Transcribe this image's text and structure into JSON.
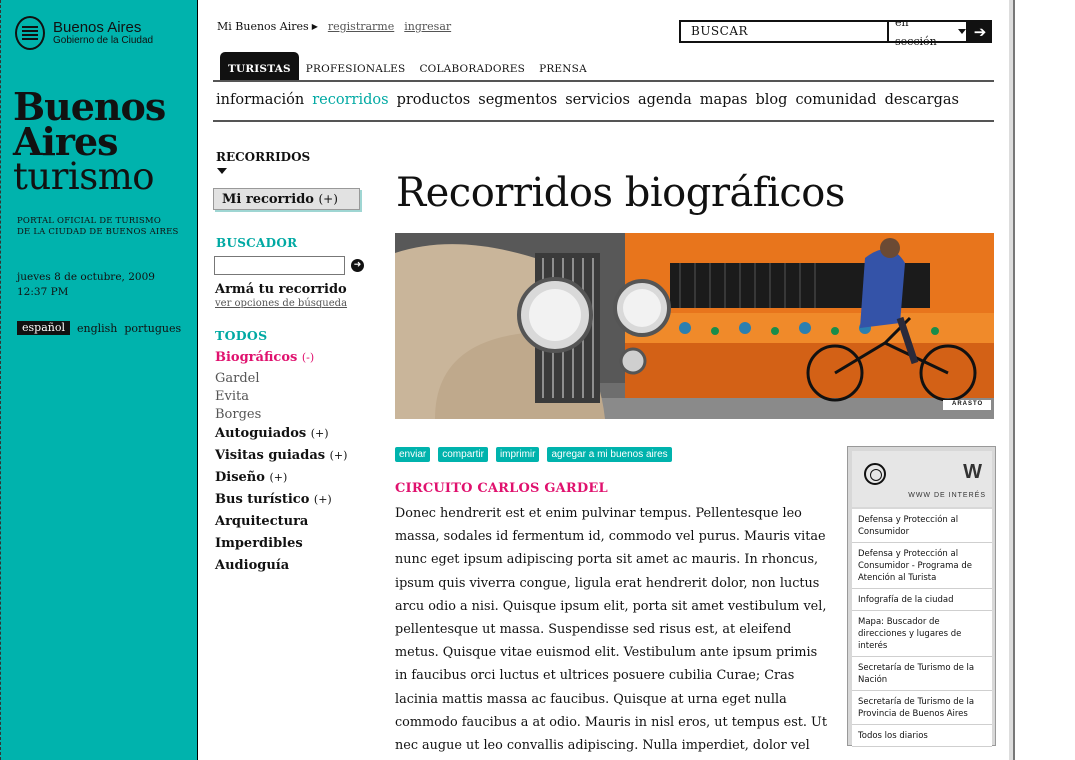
{
  "colors": {
    "teal": "#00b3ad",
    "pink": "#e0116e",
    "dark": "#111111"
  },
  "brand": {
    "logo_line1": "Buenos Aires",
    "logo_line2": "Gobierno de la Ciudad",
    "title_line1": "Buenos",
    "title_line2": "Aires",
    "title_line3": "turismo",
    "portal_line1": "PORTAL OFICIAL DE TURISMO",
    "portal_line2": "DE LA CIUDAD DE BUENOS AIRES",
    "date": "jueves 8 de octubre, 2009",
    "time": "12:37 PM"
  },
  "languages": [
    "español",
    "english",
    "portugues"
  ],
  "topnav": {
    "user": "Mi Buenos Aires",
    "register": "registrarme",
    "login": "ingresar"
  },
  "search": {
    "placeholder": "BUSCAR",
    "scope": "en sección"
  },
  "audience_tabs": [
    "TURISTAS",
    "PROFESIONALES",
    "COLABORADORES",
    "PRENSA"
  ],
  "main_nav": [
    "información",
    "recorridos",
    "productos",
    "segmentos",
    "servicios",
    "agenda",
    "mapas",
    "blog",
    "comunidad",
    "descargas"
  ],
  "sidebar": {
    "section_title": "RECORRIDOS",
    "mi_recorrido": "Mi recorrido",
    "mi_recorrido_toggle": "(+)",
    "buscador_title": "BUSCADOR",
    "arma": "Armá tu recorrido",
    "opciones": "ver opciones de búsqueda",
    "todos": "TODOS",
    "biograficos": "Biográficos",
    "biograficos_toggle": "(-)",
    "sub": [
      "Gardel",
      "Evita",
      "Borges"
    ],
    "autoguiados": "Autoguiados",
    "visitas": "Visitas guiadas",
    "diseno": "Diseño",
    "bus": "Bus turístico",
    "toggle": "(+)",
    "arquitectura": "Arquitectura",
    "imperdibles": "Imperdibles",
    "audioguia": "Audioguía"
  },
  "content": {
    "title": "Recorridos biográficos",
    "photo_credit": "ARASTO",
    "actions": [
      "enviar",
      "compartir",
      "imprimir",
      "agregar a mi buenos aires"
    ],
    "subtitle": "CIRCUITO CARLOS GARDEL",
    "body": "Donec hendrerit est et enim pulvinar tempus. Pellentesque leo massa, sodales id fermentum id, commodo vel purus. Mauris vitae nunc eget ipsum adipiscing porta sit amet ac mauris. In rhoncus, ipsum quis viverra congue, ligula erat hendrerit dolor, non luctus arcu odio a nisi. Quisque ipsum elit, porta sit amet vestibulum vel, pellentesque ut massa. Suspendisse sed risus est, at eleifend metus. Quisque vitae euismod elit. Vestibulum ante ipsum primis in faucibus orci luctus et ultrices posuere cubilia Curae; Cras lacinia mattis massa ac faucibus. Quisque at urna eget nulla commodo faucibus a at odio. Mauris in nisl eros, ut tempus est. Ut nec augue ut leo convallis adipiscing. Nulla imperdiet, dolor vel iaculis fermentum, dui elit dapibus ipsum, vitae"
  },
  "www": {
    "letter": "W",
    "label": "WWW DE INTERÉS",
    "links": [
      "Defensa y Protección al Consumidor",
      "Defensa y Protección al Consumidor - Programa de Atención al Turista",
      "Infografía de la ciudad",
      "Mapa: Buscador de direcciones y lugares de interés",
      "Secretaría de Turismo de la Nación",
      "Secretaría de Turismo de la Provincia de Buenos Aires",
      "Todos los diarios"
    ]
  }
}
